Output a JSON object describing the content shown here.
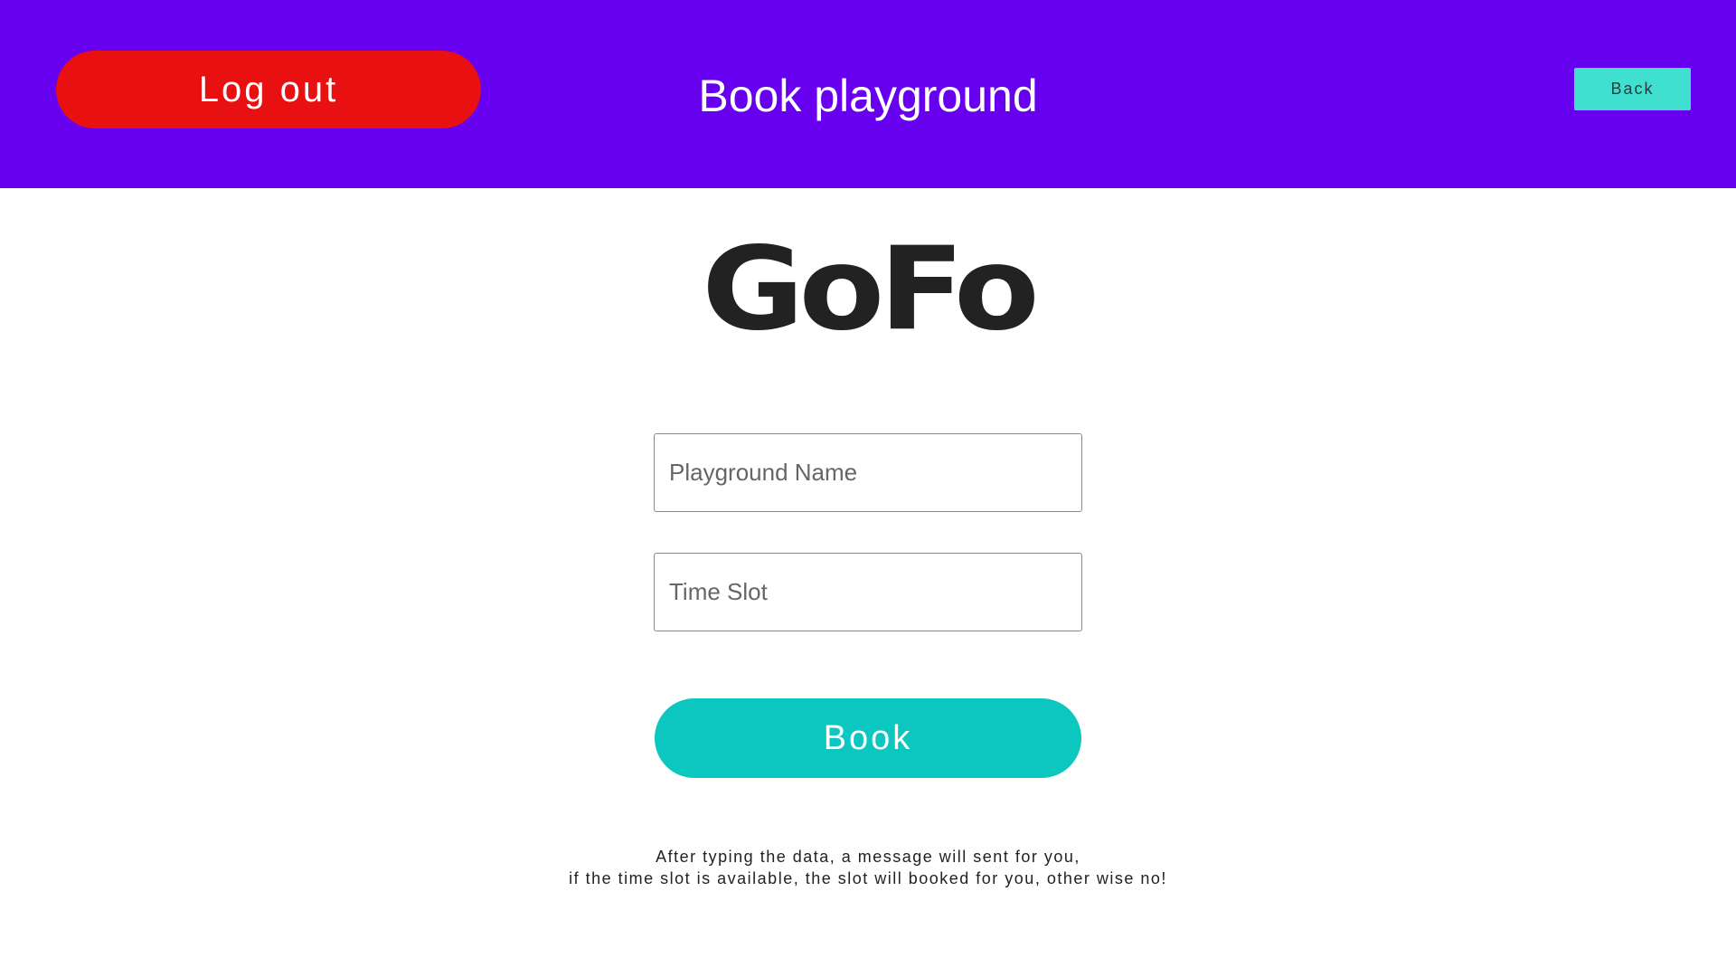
{
  "header": {
    "logout_label": "Log out",
    "title": "Book playground",
    "back_label": "Back"
  },
  "logo": {
    "text": "GoFo"
  },
  "form": {
    "playground_name": {
      "value": "",
      "placeholder": "Playground Name"
    },
    "time_slot": {
      "value": "",
      "placeholder": "Time Slot"
    },
    "book_label": "Book"
  },
  "note": {
    "line1": "After typing the data, a message will sent for you,",
    "line2": "if the time slot is available, the slot will booked for you, other wise no!"
  },
  "colors": {
    "header_bg": "#6600ee",
    "logout_bg": "#e81010",
    "back_bg": "#40e0d0",
    "book_bg": "#0cc6c0"
  }
}
